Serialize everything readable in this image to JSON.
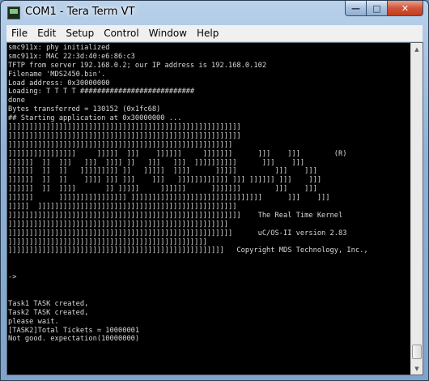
{
  "window": {
    "title": "COM1 - Tera Term VT",
    "buttons": {
      "minimize": "—",
      "maximize": "□",
      "close": "✕"
    }
  },
  "menu": [
    "File",
    "Edit",
    "Setup",
    "Control",
    "Window",
    "Help"
  ],
  "terminal": {
    "lines": [
      "smc911x: phy initialized",
      "smc911x: MAC 22:3d:40:e6:86:c3",
      "TFTP from server 192.168.0.2; our IP address is 192.168.0.102",
      "Filename 'MDS2450.bin'.",
      "Load address: 0x30000000",
      "Loading: T T T T ###########################",
      "done",
      "Bytes transferred = 130152 (0x1fc68)",
      "## Starting application at 0x30000000 ...",
      "]]]]]]]]]]]]]]]]]]]]]]]]]]]]]]]]]]]]]]]]]]]]]]]]]]]]]]]",
      "]]]]]]]]]]]]]]]]]]]]]]]]]]]]]]]]]]]]]]]]]]]]]]]]]]]]]]]",
      "]]]]]]]]]]]]]]]]]]]]]]]]]]]]]]]]]]]]]]]]]]]]]]]]]]]]]",
      "]]]]]]]]]]]]]]]]     ]]]]]  ]]]    ]]]]]]     ]]]]]]]      ]]]    ]]]        (R)",
      "]]]]]]  ]]  ]]]   ]]]  ]]]] ]]   ]]]   ]]]  ]]]]]]]]]]      ]]]    ]]]",
      "]]]]]]  ]]  ]]   ]]]]]]]]] ]]   ]]]]]  ]]]]      ]]]]]         ]]]    ]]]",
      "]]]]]]  ]]  ]]    ]]]] ]]] ]]]    ]]]   ]]]]]]]]]]]] ]]] ]]]]]] ]]]    ]]]",
      "]]]]]]  ]]  ]]]]       ]] ]]]]]     ]]]]]]      ]]]]]]]        ]]]    ]]]",
      "]]]]]]      ]]]]]]]]]]]]]]]] ]]]]]]]]]]]]]]]]]]]]]]]]]]]]]]]      ]]]    ]]]",
      "]]]]]  ]]]]]]]]]]]]]]]]]]]]]]]]]]]]]]]]]]]]]]]]]]]]]]]",
      "]]]]]]]]]]]]]]]]]]]]]]]]]]]]]]]]]]]]]]]]]]]]]]]]]]]]]]]    The Real Time Kernel",
      "]]]]]]]]]]]]]]]]]]]]]]]]]]]]]]]]]]]]]]]]]]]]]]]]]]]]",
      "]]]]]]]]]]]]]]]]]]]]]]]]]]]]]]]]]]]]]]]]]]]]]]]]]]]]]      uC/OS-II version 2.83",
      "]]]]]]]]]]]]]]]]]]]]]]]]]]]]]]]]]]]]]]]]]]]]]]]",
      "]]]]]]]]]]]]]]]]]]]]]]]]]]]]]]]]]]]]]]]]]]]]]]]]]]]   Copyright MDS Technology, Inc.,",
      "",
      "",
      "->",
      "",
      "",
      "Task1 TASK created,",
      "Task2 TASK created,",
      "please wait.",
      "[TASK2]Total Tickets = 10000001",
      "Not good. expectation(10000000)"
    ]
  }
}
